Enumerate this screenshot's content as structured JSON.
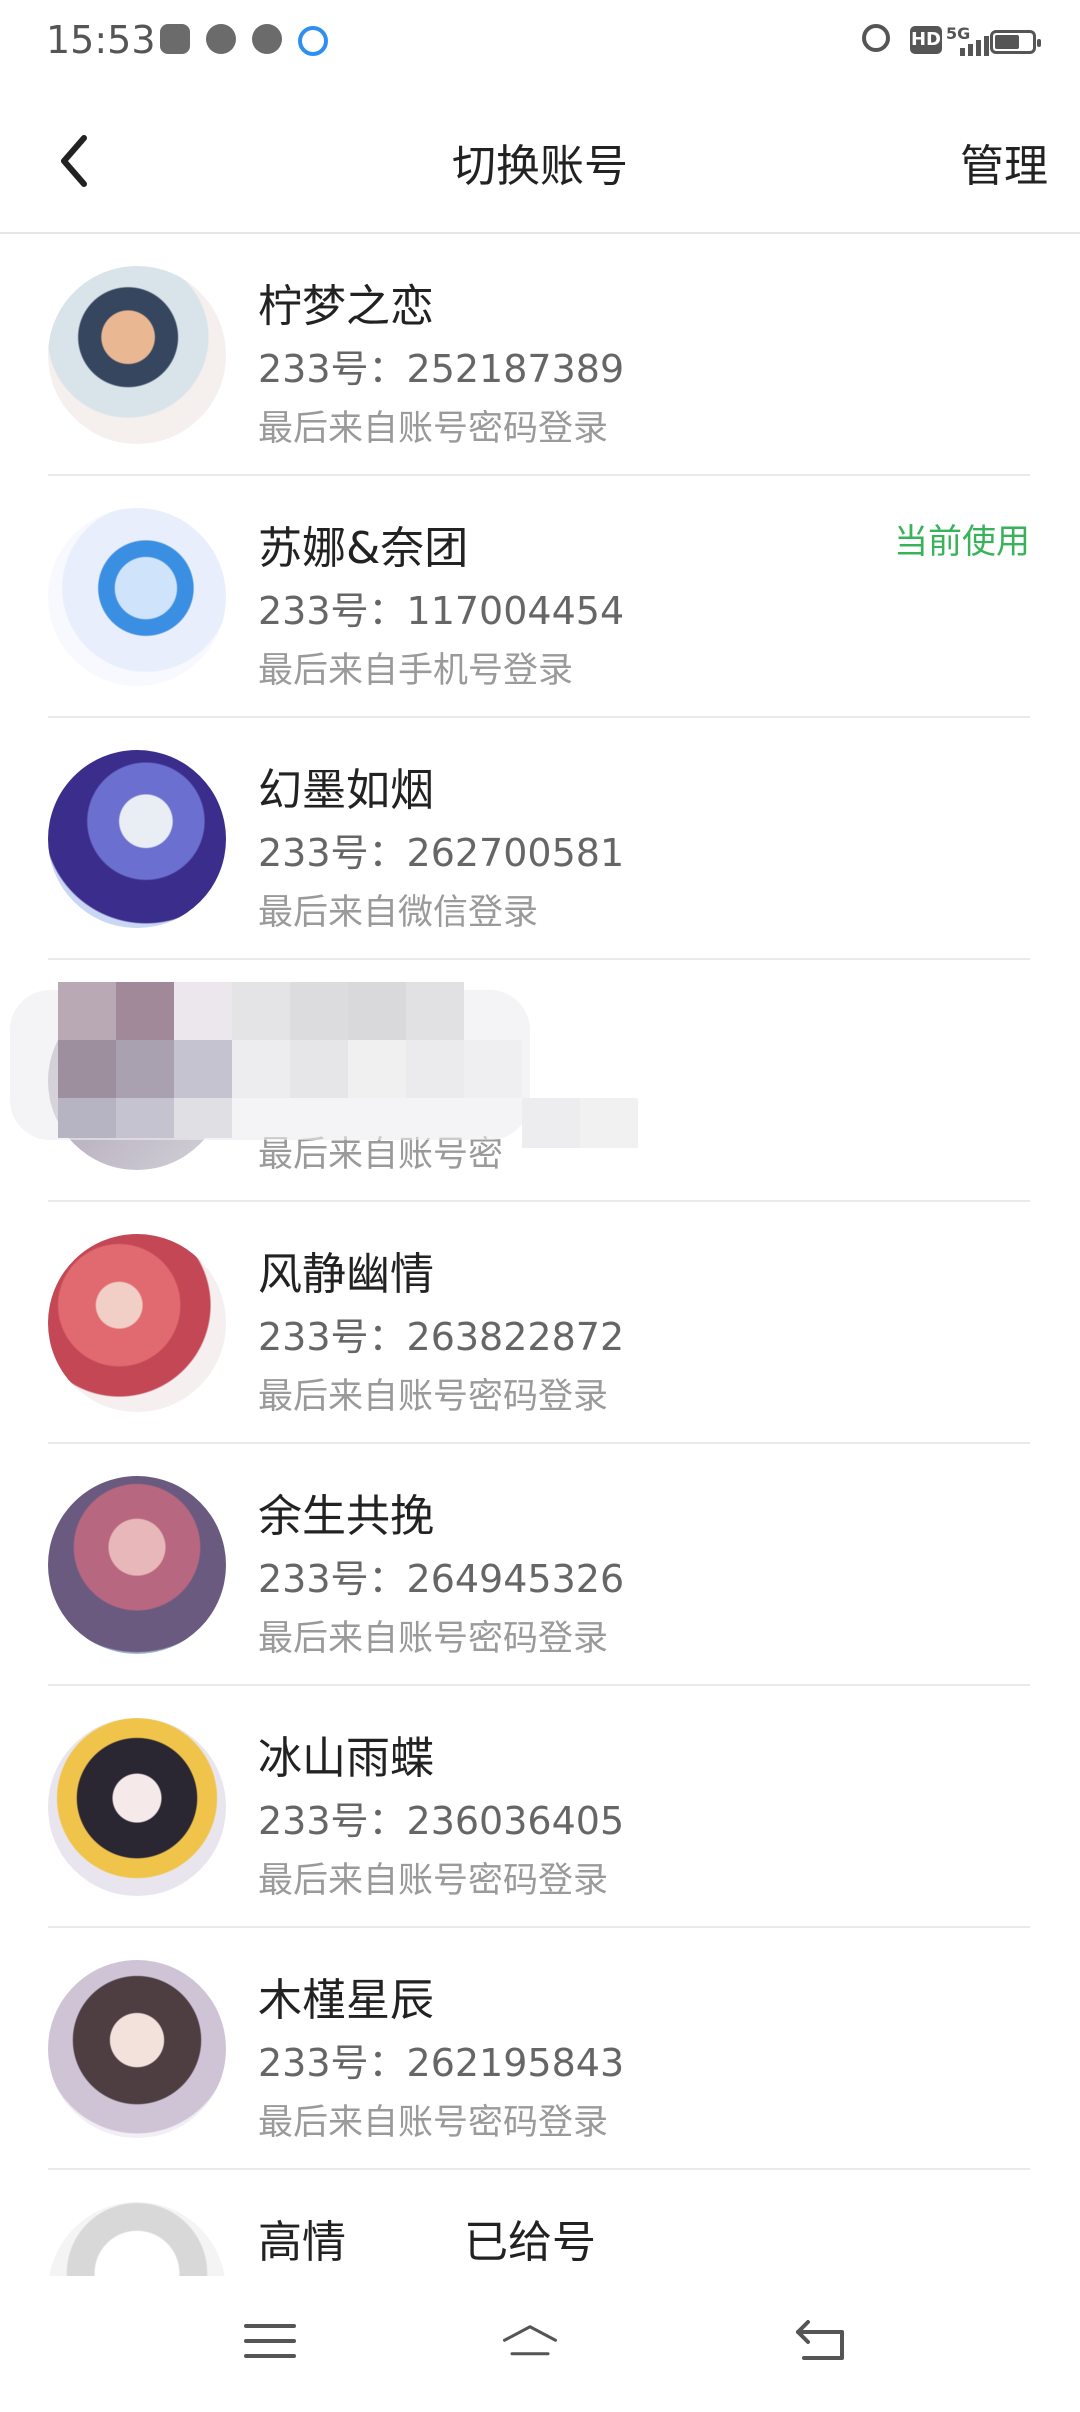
{
  "status_bar": {
    "time": "15:53",
    "icons": [
      "screenshot-icon",
      "speed-icon",
      "video-icon",
      "browser-icon",
      "alarm-icon",
      "hd-icon",
      "5g-signal-icon",
      "battery-icon"
    ],
    "network": "5G",
    "hd": "HD"
  },
  "nav": {
    "back_icon": "chevron-left-icon",
    "title": "切换账号",
    "manage_label": "管理"
  },
  "accounts": [
    {
      "name": "柠梦之恋",
      "uid": "233号：252187389",
      "source": "最后来自账号密码登录",
      "badge": ""
    },
    {
      "name": "苏娜&奈团",
      "uid": "233号：117004454",
      "source": "最后来自手机号登录",
      "badge": "当前使用"
    },
    {
      "name": "幻墨如烟",
      "uid": "233号：262700581",
      "source": "最后来自微信登录",
      "badge": ""
    },
    {
      "name": "",
      "uid": "",
      "source": "最后来自账号密",
      "badge": ""
    },
    {
      "name": "风静幽情",
      "uid": "233号：263822872",
      "source": "最后来自账号密码登录",
      "badge": ""
    },
    {
      "name": "余生共挽",
      "uid": "233号：264945326",
      "source": "最后来自账号密码登录",
      "badge": ""
    },
    {
      "name": "冰山雨蝶",
      "uid": "233号：236036405",
      "source": "最后来自账号密码登录",
      "badge": ""
    },
    {
      "name": "木槿星辰",
      "uid": "233号：262195843",
      "source": "最后来自账号密码登录",
      "badge": ""
    },
    {
      "name": "高情",
      "name_extra": "已给号",
      "uid": "",
      "source": "",
      "badge": ""
    }
  ],
  "colors": {
    "accent_green": "#39b35a",
    "text_primary": "#222222",
    "text_secondary": "#666666",
    "text_tertiary": "#9a9a9a"
  },
  "bottom_nav": {
    "icons": [
      "menu-icon",
      "home-icon",
      "back-icon"
    ]
  }
}
